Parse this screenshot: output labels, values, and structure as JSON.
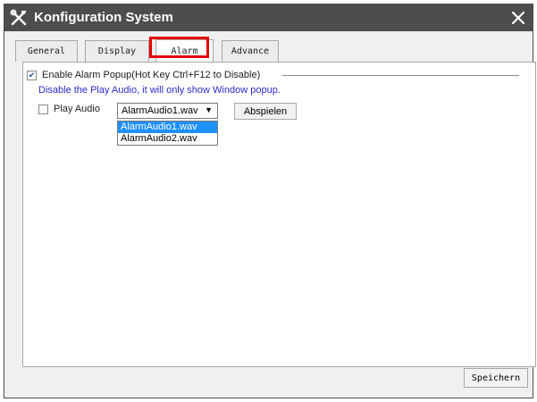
{
  "window": {
    "title": "Konfiguration System",
    "icons": {
      "app": "tools-icon",
      "close": "close-icon"
    }
  },
  "tabs": [
    {
      "label": "General"
    },
    {
      "label": "Display"
    },
    {
      "label": "Alarm",
      "active": true
    },
    {
      "label": "Advance"
    }
  ],
  "alarm": {
    "enable_popup_label": "Enable Alarm Popup(Hot Key Ctrl+F12 to Disable)",
    "enable_popup_checked": true,
    "note": "Disable the Play Audio, it will only show Window popup.",
    "play_audio_label": "Play Audio",
    "play_audio_checked": false,
    "audio_select_value": "AlarmAudio1.wav",
    "audio_options": [
      "AlarmAudio1.wav",
      "AlarmAudio2.wav"
    ],
    "play_button": "Abspielen"
  },
  "footer": {
    "save_button": "Speichern"
  },
  "colors": {
    "titlebar": "#4d4d4d",
    "highlight": "#e50000",
    "note_text": "#2a2acb",
    "selection": "#1e90ff"
  }
}
